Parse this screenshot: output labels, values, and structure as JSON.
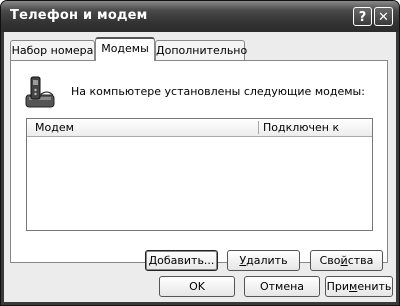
{
  "window": {
    "title": "Телефон и модем",
    "help_glyph": "?",
    "close_glyph": "✕"
  },
  "tabs": [
    {
      "label": "Набор номера"
    },
    {
      "label": "Модемы"
    },
    {
      "label": "Дополнительно"
    }
  ],
  "modems_tab": {
    "info_text": "На компьютере установлены следующие модемы:",
    "columns": [
      "Модем",
      "Подключен к"
    ],
    "rows": [],
    "buttons": {
      "add": {
        "underline": "Д",
        "rest": "обавить..."
      },
      "remove": {
        "underline": "У",
        "rest": "далить"
      },
      "properties": {
        "pre": "Сво",
        "underline": "й",
        "rest": "ства"
      }
    }
  },
  "footer": {
    "ok": "OK",
    "cancel": "Отмена",
    "apply": {
      "pre": "При",
      "underline": "м",
      "rest": "енить"
    }
  },
  "icons": {
    "modem": "modem-phone-icon"
  }
}
